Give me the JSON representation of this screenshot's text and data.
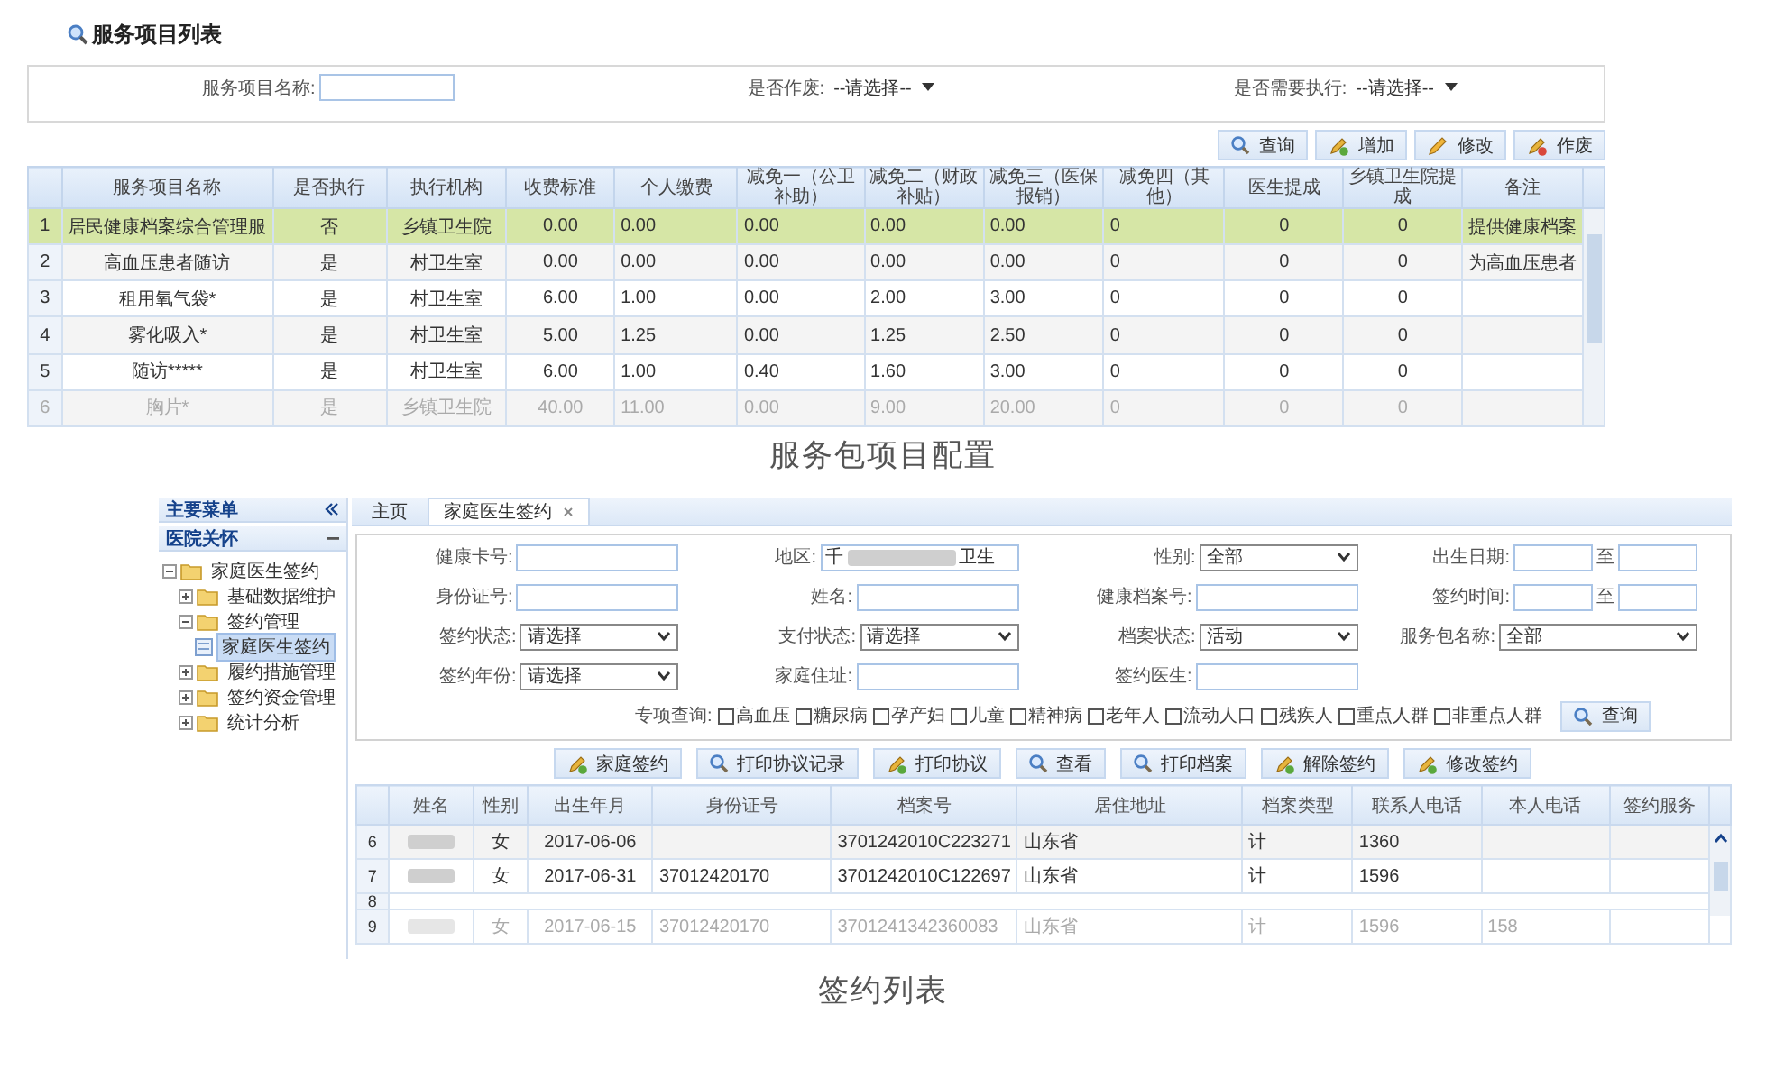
{
  "service_panel": {
    "title": "服务项目列表",
    "filters": [
      {
        "kind": "text",
        "label": "服务项目名称:"
      },
      {
        "kind": "select",
        "label": "是否作废:",
        "value": "--请选择--"
      },
      {
        "kind": "select",
        "label": "是否需要执行:",
        "value": "--请选择--"
      }
    ],
    "toolbar": [
      {
        "kind": "search",
        "label": "查询"
      },
      {
        "kind": "add",
        "label": "增加"
      },
      {
        "kind": "edit",
        "label": "修改"
      },
      {
        "kind": "void",
        "label": "作废"
      }
    ],
    "table": {
      "columns": [
        "服务项目名称",
        "是否执行",
        "执行机构",
        "收费标准",
        "个人缴费",
        "减免一（公卫补助）",
        "减免二（财政补贴）",
        "减免三（医保报销）",
        "减免四（其他）",
        "医生提成",
        "乡镇卫生院提成",
        "备注"
      ],
      "rows": [
        {
          "index": "1",
          "selected": true,
          "dimmed": false,
          "cells": [
            "居民健康档案综合管理服",
            "否",
            "乡镇卫生院",
            "0.00",
            "0.00",
            "0.00",
            "0.00",
            "0.00",
            "0",
            "0",
            "0",
            "提供健康档案"
          ]
        },
        {
          "index": "2",
          "selected": false,
          "dimmed": false,
          "cells": [
            "高血压患者随访",
            "是",
            "村卫生室",
            "0.00",
            "0.00",
            "0.00",
            "0.00",
            "0.00",
            "0",
            "0",
            "0",
            "为高血压患者"
          ]
        },
        {
          "index": "3",
          "selected": false,
          "dimmed": false,
          "cells": [
            "租用氧气袋*",
            "是",
            "村卫生室",
            "6.00",
            "1.00",
            "0.00",
            "2.00",
            "3.00",
            "0",
            "0",
            "0",
            ""
          ]
        },
        {
          "index": "4",
          "selected": false,
          "dimmed": false,
          "cells": [
            "雾化吸入*",
            "是",
            "村卫生室",
            "5.00",
            "1.25",
            "0.00",
            "1.25",
            "2.50",
            "0",
            "0",
            "0",
            ""
          ]
        },
        {
          "index": "5",
          "selected": false,
          "dimmed": false,
          "cells": [
            "随访*****",
            "是",
            "村卫生室",
            "6.00",
            "1.00",
            "0.40",
            "1.60",
            "3.00",
            "0",
            "0",
            "0",
            ""
          ]
        },
        {
          "index": "6",
          "selected": false,
          "dimmed": true,
          "cells": [
            "胸片*",
            "是",
            "乡镇卫生院",
            "40.00",
            "11.00",
            "0.00",
            "9.00",
            "20.00",
            "0",
            "0",
            "0",
            ""
          ]
        }
      ]
    }
  },
  "caption_1": "服务包项目配置",
  "signing_panel": {
    "sidebar": {
      "title": "主要菜单",
      "section": "医院关怀",
      "tree": [
        {
          "label": "家庭医生签约",
          "expanded": true,
          "selected": false,
          "children": [
            {
              "label": "基础数据维护",
              "expanded": false,
              "selected": false
            },
            {
              "label": "签约管理",
              "expanded": true,
              "selected": false,
              "children": [
                {
                  "label": "家庭医生签约",
                  "kind": "page",
                  "selected": true
                }
              ]
            },
            {
              "label": "履约措施管理",
              "expanded": false,
              "selected": false
            },
            {
              "label": "签约资金管理",
              "expanded": false,
              "selected": false
            },
            {
              "label": "统计分析",
              "expanded": false,
              "selected": false
            }
          ]
        }
      ]
    },
    "tabs": [
      {
        "label": "主页",
        "selected": false,
        "closable": false
      },
      {
        "label": "家庭医生签约",
        "selected": true,
        "closable": true
      }
    ],
    "form": [
      [
        {
          "kind": "text",
          "label": "健康卡号:"
        },
        {
          "kind": "region",
          "label": "地区:",
          "value": "千",
          "suffix": "卫生"
        },
        {
          "kind": "select",
          "label": "性别:",
          "value": "全部"
        },
        {
          "kind": "range",
          "label": "出生日期:",
          "separator": "至"
        }
      ],
      [
        {
          "kind": "text",
          "label": "身份证号:"
        },
        {
          "kind": "text",
          "label": "姓名:"
        },
        {
          "kind": "text",
          "label": "健康档案号:"
        },
        {
          "kind": "range",
          "label": "签约时间:",
          "separator": "至"
        }
      ],
      [
        {
          "kind": "select",
          "label": "签约状态:",
          "value": "请选择"
        },
        {
          "kind": "select",
          "label": "支付状态:",
          "value": "请选择"
        },
        {
          "kind": "select",
          "label": "档案状态:",
          "value": "活动"
        },
        {
          "kind": "select",
          "label": "服务包名称:",
          "value": "全部"
        }
      ],
      [
        {
          "kind": "select",
          "label": "签约年份:",
          "value": "请选择"
        },
        {
          "kind": "text",
          "label": "家庭住址:"
        },
        {
          "kind": "text",
          "label": "签约医生:"
        }
      ]
    ],
    "special": {
      "label": "专项查询:",
      "options": [
        {
          "label": "高血压",
          "checked": false
        },
        {
          "label": "糖尿病",
          "checked": false
        },
        {
          "label": "孕产妇",
          "checked": false
        },
        {
          "label": "儿童",
          "checked": false
        },
        {
          "label": "精神病",
          "checked": false
        },
        {
          "label": "老年人",
          "checked": false
        },
        {
          "label": "流动人口",
          "checked": false
        },
        {
          "label": "残疾人",
          "checked": false
        },
        {
          "label": "重点人群",
          "checked": false
        },
        {
          "label": "非重点人群",
          "checked": false
        }
      ],
      "button": {
        "kind": "search",
        "label": "查询"
      }
    },
    "actions": [
      {
        "kind": "add",
        "label": "家庭签约"
      },
      {
        "kind": "search",
        "label": "打印协议记录"
      },
      {
        "kind": "add",
        "label": "打印协议"
      },
      {
        "kind": "search",
        "label": "查看"
      },
      {
        "kind": "search",
        "label": "打印档案"
      },
      {
        "kind": "add",
        "label": "解除签约"
      },
      {
        "kind": "add",
        "label": "修改签约"
      }
    ],
    "table": {
      "columns": [
        "姓名",
        "性别",
        "出生年月",
        "身份证号",
        "档案号",
        "居住地址",
        "档案类型",
        "联系人电话",
        "本人电话",
        "签约服务"
      ],
      "rows": [
        {
          "index": "6",
          "kind": "full",
          "name_redacted": true,
          "dimmed": false,
          "cells": [
            "",
            "女",
            "2017-06-06",
            "",
            "3701242010C223271",
            "山东省",
            "计",
            "1360",
            "",
            ""
          ]
        },
        {
          "index": "7",
          "kind": "full",
          "name_redacted": true,
          "dimmed": false,
          "cells": [
            "",
            "女",
            "2017-06-31",
            "37012420170",
            "3701242010C122697",
            "山东省",
            "计",
            "1596",
            "",
            ""
          ]
        },
        {
          "index": "8",
          "kind": "stub",
          "cells": []
        },
        {
          "index": "9",
          "kind": "full",
          "name_redacted": true,
          "dimmed": true,
          "cells": [
            "",
            "女",
            "2017-06-15",
            "37012420170",
            "3701241342360083",
            "山东省",
            "计",
            "1596",
            "158",
            ""
          ]
        }
      ]
    }
  },
  "caption_2": "签约列表"
}
